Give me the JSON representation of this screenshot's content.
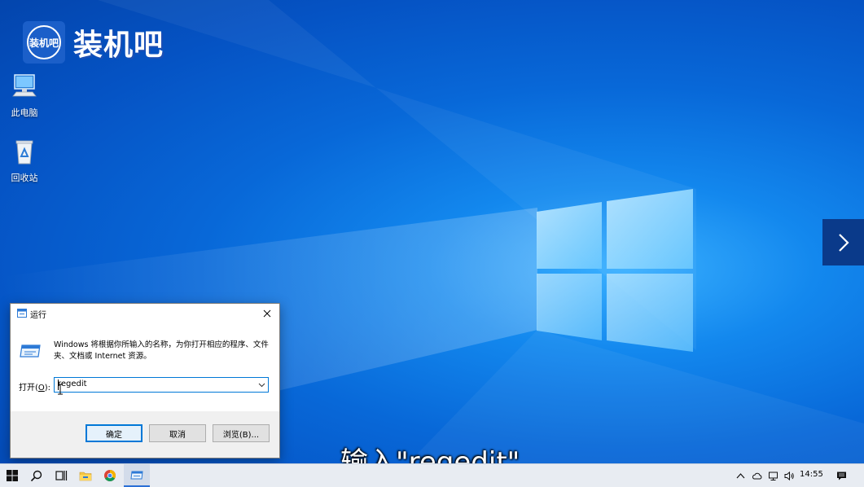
{
  "watermark": {
    "badge_text": "装机吧",
    "text": "装机吧"
  },
  "desktop_icons": [
    {
      "label": "此电脑",
      "icon": "this-pc-icon"
    },
    {
      "label": "回收站",
      "icon": "recycle-bin-icon"
    }
  ],
  "run_dialog": {
    "title": "运行",
    "description": "Windows 将根据你所输入的名称，为你打开相应的程序、文件夹、文档或 Internet 资源。",
    "open_label_prefix": "打开(",
    "open_label_key": "O",
    "open_label_suffix": "):",
    "input_value": "regedit",
    "ok_label": "确定",
    "cancel_label": "取消",
    "browse_label": "浏览(B)..."
  },
  "subtitle": "输入\"regedit\"",
  "taskbar": {
    "items": [
      "start-icon",
      "search-icon",
      "task-view-icon",
      "file-explorer-icon",
      "chrome-icon",
      "run-icon"
    ],
    "tray": [
      "chevron-up-icon",
      "onedrive-icon",
      "network-icon",
      "volume-icon"
    ],
    "time": "14:55"
  },
  "colors": {
    "desktop": "#0868d8",
    "accent": "#0078d7",
    "taskbar": "#e8ecf2"
  }
}
